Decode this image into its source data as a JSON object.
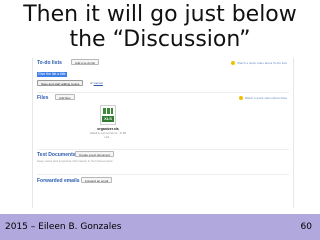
{
  "slide": {
    "title_line1": "Then it will go just below",
    "title_line2": "the “Discussion”"
  },
  "screenshot": {
    "todo": {
      "title": "To-do lists",
      "add_button": "Add a to-do list",
      "help_link": "Watch a quick video about To-Do lists",
      "new_list_name": "Give the list a title",
      "save_button": "Save and start adding to-dos",
      "or_text": "or",
      "cancel_link": "Cancel"
    },
    "files": {
      "title": "Files",
      "add_button": "Add files",
      "help_link": "Watch a quick video about Files",
      "file_badge": "XLS",
      "file_name": "organizer.xls",
      "file_meta": "Added by Lori on Feb 21 · 11 KB",
      "file_links": "Link…"
    },
    "text_documents": {
      "title": "Text Documents",
      "add_button": "Create a text document",
      "description": "Keep notes and important information in Text Documents."
    },
    "forwarded_emails": {
      "title": "Forwarded emails",
      "add_button": "Forward an email"
    }
  },
  "footer": {
    "left": "2015 – Eileen B. Gonzales",
    "page_number": "60"
  },
  "colors": {
    "footer_bg": "#b1a8de",
    "section_title": "#2a5db0",
    "highlight": "#3d7ee8"
  },
  "icons": {
    "help": "video-help-icon",
    "file": "xls-file-icon"
  }
}
